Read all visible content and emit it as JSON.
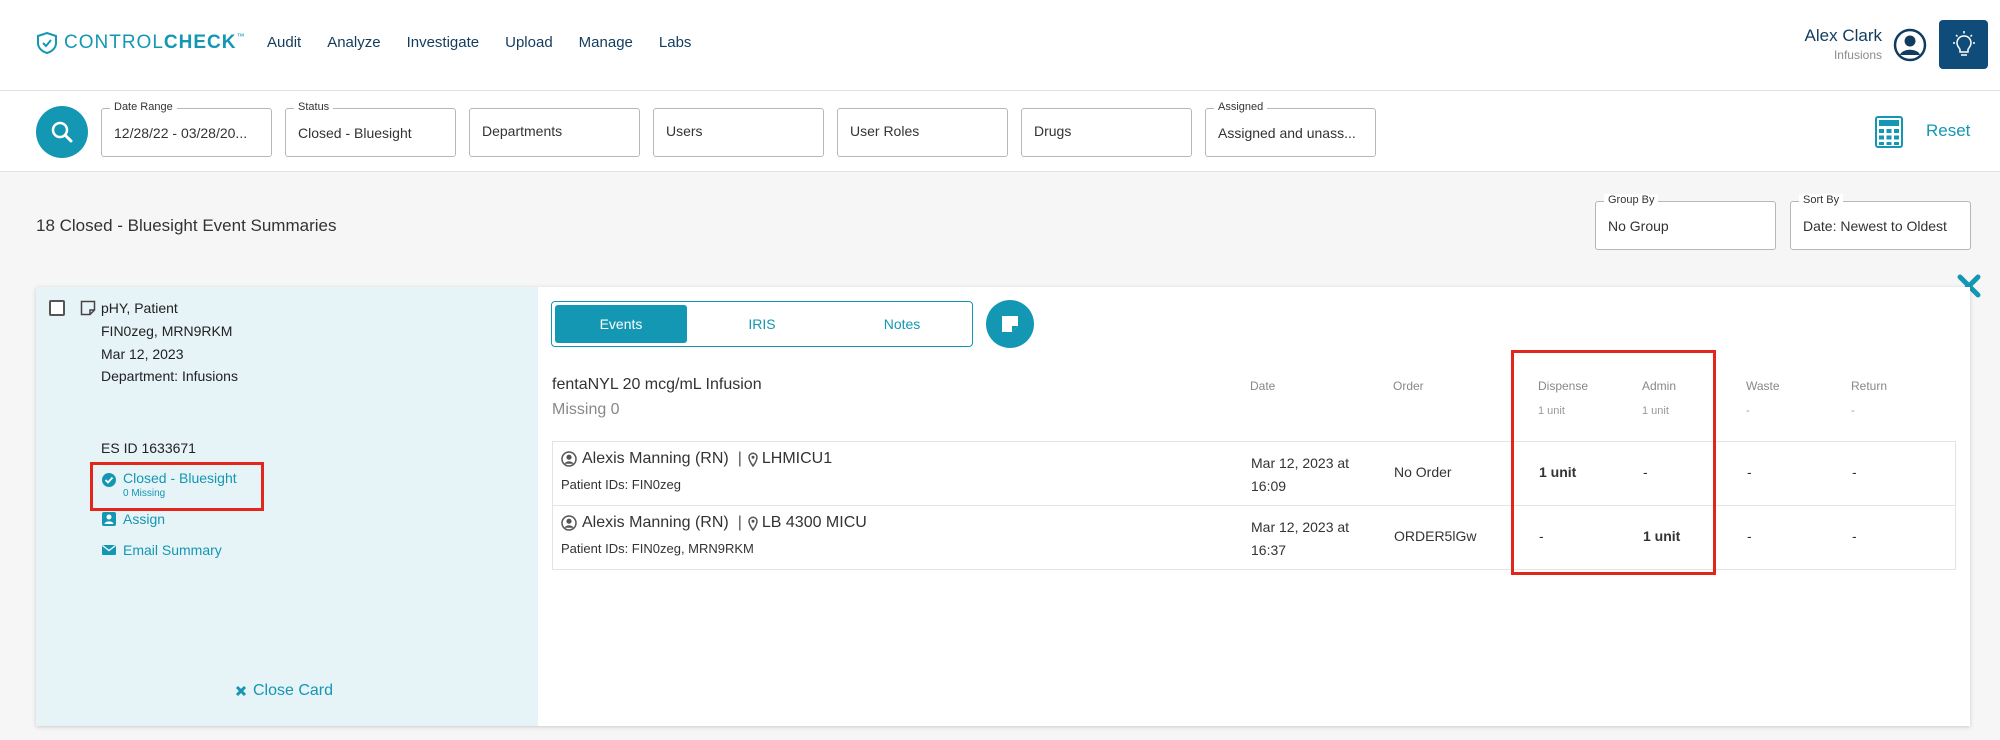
{
  "brand": {
    "name_part1": "CONTROL",
    "name_part2": "CHECK",
    "tm": "™"
  },
  "nav": [
    "Audit",
    "Analyze",
    "Investigate",
    "Upload",
    "Manage",
    "Labs"
  ],
  "user": {
    "name": "Alex Clark",
    "department": "Infusions"
  },
  "filters": {
    "date_range": {
      "label": "Date Range",
      "value": "12/28/22 - 03/28/20..."
    },
    "status": {
      "label": "Status",
      "value": "Closed - Bluesight"
    },
    "departments": {
      "value": "Departments"
    },
    "users": {
      "value": "Users"
    },
    "user_roles": {
      "value": "User Roles"
    },
    "drugs": {
      "value": "Drugs"
    },
    "assigned": {
      "label": "Assigned",
      "value": "Assigned and unass..."
    },
    "reset": "Reset"
  },
  "summary": {
    "count_text": "18 Closed - Bluesight Event Summaries",
    "group_by": {
      "label": "Group By",
      "value": "No Group"
    },
    "sort_by": {
      "label": "Sort By",
      "value": "Date: Newest to Oldest"
    }
  },
  "card": {
    "patient": {
      "name": "pHY, Patient",
      "ids": "FIN0zeg, MRN9RKM",
      "date": "Mar 12, 2023",
      "department_label": "Department: ",
      "department": "Infusions"
    },
    "es_id": "ES ID 1633671",
    "status": {
      "label": "Closed - Bluesight",
      "sub": "0 Missing"
    },
    "actions": {
      "assign": "Assign",
      "email": "Email Summary"
    },
    "close_card": "Close Card",
    "tabs": [
      {
        "label": "Events",
        "active": true
      },
      {
        "label": "IRIS",
        "active": false
      },
      {
        "label": "Notes",
        "active": false
      }
    ],
    "drug": {
      "name": "fentaNYL 20 mcg/mL Infusion",
      "missing": "Missing 0"
    },
    "columns": {
      "date": "Date",
      "order": "Order",
      "dispense": "Dispense",
      "admin": "Admin",
      "waste": "Waste",
      "return": "Return"
    },
    "totals": {
      "dispense": "1 unit",
      "admin": "1 unit",
      "waste": "-",
      "return": "-"
    },
    "events": [
      {
        "person": "Alexis Manning (RN)",
        "location": "LHMICU1",
        "patient_ids": "Patient IDs: FIN0zeg",
        "date": "Mar 12, 2023 at 16:09",
        "order": "No Order",
        "dispense": "1 unit",
        "admin": "-",
        "waste": "-",
        "return": "-"
      },
      {
        "person": "Alexis Manning (RN)",
        "location": "LB 4300 MICU",
        "patient_ids": "Patient IDs: FIN0zeg, MRN9RKM",
        "date": "Mar 12, 2023 at 16:37",
        "order": "ORDER5lGw",
        "dispense": "-",
        "admin": "1 unit",
        "waste": "-",
        "return": "-"
      }
    ]
  },
  "colors": {
    "accent": "#1497b3",
    "navy": "#123c5e",
    "highlight": "#e3261c",
    "panel": "#e6f3f7"
  }
}
